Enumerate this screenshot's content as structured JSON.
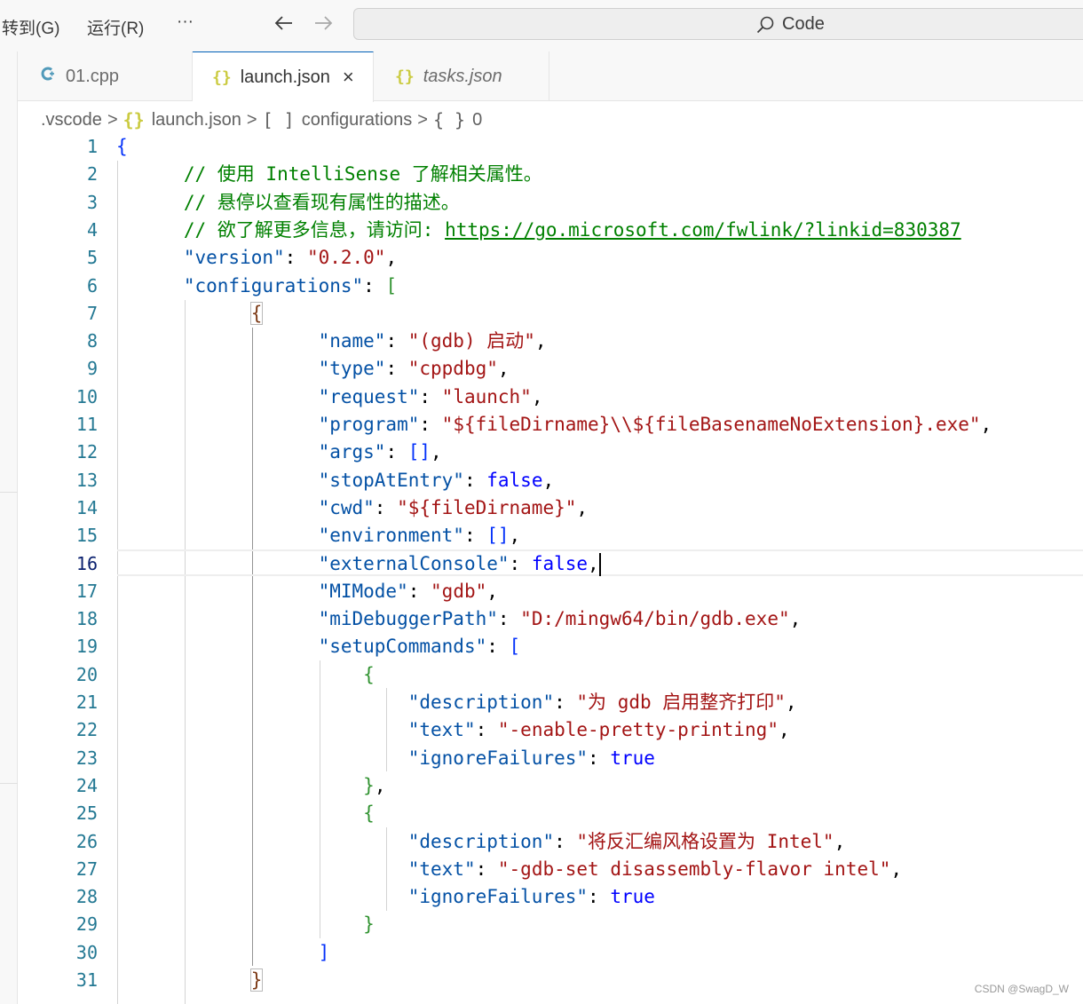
{
  "menu": {
    "goto": "转到(G)",
    "run": "运行(R)",
    "more": "···"
  },
  "nav": {
    "back_icon": "arrow-left-icon",
    "forward_icon": "arrow-right-icon"
  },
  "command_center": {
    "icon": "search-icon",
    "label": "Code"
  },
  "tabs": [
    {
      "label": "01.cpp",
      "icon": "cpp-file-icon",
      "active": false,
      "italic": false
    },
    {
      "label": "launch.json",
      "icon": "json-file-icon",
      "active": true,
      "italic": false,
      "close": "×"
    },
    {
      "label": "tasks.json",
      "icon": "json-file-icon",
      "active": false,
      "italic": true
    }
  ],
  "breadcrumb": {
    "folder": ".vscode",
    "file": "launch.json",
    "array_icon": "[ ]",
    "array_label": "configurations",
    "object_icon": "{ }",
    "object_label": "0",
    "separator": ">"
  },
  "editor": {
    "current_line": 16,
    "lines": [
      {
        "n": "1"
      },
      {
        "n": "2"
      },
      {
        "n": "3"
      },
      {
        "n": "4"
      },
      {
        "n": "5"
      },
      {
        "n": "6"
      },
      {
        "n": "7"
      },
      {
        "n": "8"
      },
      {
        "n": "9"
      },
      {
        "n": "10"
      },
      {
        "n": "11"
      },
      {
        "n": "12"
      },
      {
        "n": "13"
      },
      {
        "n": "14"
      },
      {
        "n": "15"
      },
      {
        "n": "16"
      },
      {
        "n": "17"
      },
      {
        "n": "18"
      },
      {
        "n": "19"
      },
      {
        "n": "20"
      },
      {
        "n": "21"
      },
      {
        "n": "22"
      },
      {
        "n": "23"
      },
      {
        "n": "24"
      },
      {
        "n": "25"
      },
      {
        "n": "26"
      },
      {
        "n": "27"
      },
      {
        "n": "28"
      },
      {
        "n": "29"
      },
      {
        "n": "30"
      },
      {
        "n": "31"
      }
    ],
    "tokens": {
      "l1_open": "{",
      "l2_com": "// 使用 IntelliSense 了解相关属性。",
      "l3_com": "// 悬停以查看现有属性的描述。",
      "l4_com": "// 欲了解更多信息，请访问: ",
      "l4_link": "https://go.microsoft.com/fwlink/?linkid=830387",
      "l5_key": "\"version\"",
      "l5_val": "\"0.2.0\"",
      "l6_key": "\"configurations\"",
      "l6_br": "[",
      "l7_br": "{",
      "l8_key": "\"name\"",
      "l8_val": "\"(gdb) 启动\"",
      "l9_key": "\"type\"",
      "l9_val": "\"cppdbg\"",
      "l10_key": "\"request\"",
      "l10_val": "\"launch\"",
      "l11_key": "\"program\"",
      "l11_val": "\"${fileDirname}\\\\${fileBasenameNoExtension}.exe\"",
      "l12_key": "\"args\"",
      "l12_val": "[]",
      "l13_key": "\"stopAtEntry\"",
      "l13_val": "false",
      "l14_key": "\"cwd\"",
      "l14_val": "\"${fileDirname}\"",
      "l15_key": "\"environment\"",
      "l15_val": "[]",
      "l16_key": "\"externalConsole\"",
      "l16_val": "false",
      "l17_key": "\"MIMode\"",
      "l17_val": "\"gdb\"",
      "l18_key": "\"miDebuggerPath\"",
      "l18_val": "\"D:/mingw64/bin/gdb.exe\"",
      "l19_key": "\"setupCommands\"",
      "l19_br": "[",
      "l20_br": "{",
      "l21_key": "\"description\"",
      "l21_val": "\"为 gdb 启用整齐打印\"",
      "l22_key": "\"text\"",
      "l22_val": "\"-enable-pretty-printing\"",
      "l23_key": "\"ignoreFailures\"",
      "l23_val": "true",
      "l24_br": "}",
      "l25_br": "{",
      "l26_key": "\"description\"",
      "l26_val": "\"将反汇编风格设置为 Intel\"",
      "l27_key": "\"text\"",
      "l27_val": "\"-gdb-set disassembly-flavor intel\"",
      "l28_key": "\"ignoreFailures\"",
      "l28_val": "true",
      "l29_br": "}",
      "l30_br": "]",
      "l31_br": "}"
    }
  },
  "watermark": "CSDN @SwagD_W"
}
